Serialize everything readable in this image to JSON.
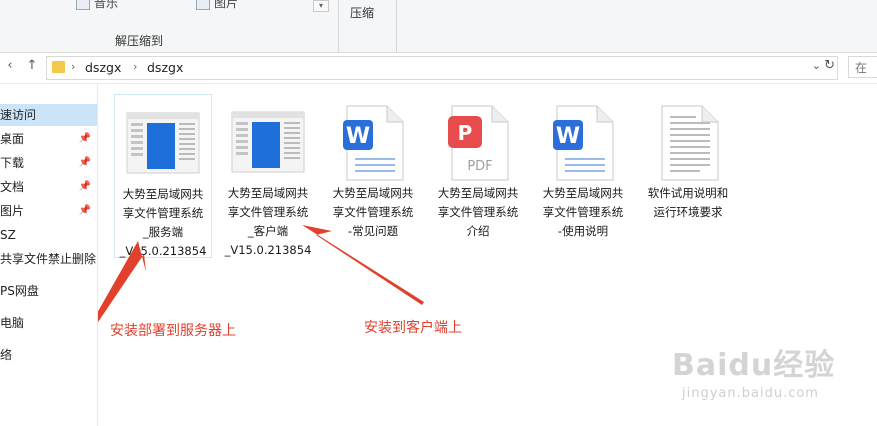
{
  "ribbon": {
    "item_music": "音乐",
    "item_pictures": "图片",
    "group_extract": "解压缩到",
    "group_compress": "压缩"
  },
  "nav": {
    "back_icon": "arrow-left-icon",
    "up_icon": "arrow-up-icon",
    "breadcrumb": [
      "dszgx",
      "dszgx"
    ],
    "search_placeholder": "在 "
  },
  "sidebar": {
    "items": [
      {
        "label": "速访问",
        "selected": true,
        "pinned": false
      },
      {
        "label": "桌面",
        "selected": false,
        "pinned": true
      },
      {
        "label": "下载",
        "selected": false,
        "pinned": true
      },
      {
        "label": "文档",
        "selected": false,
        "pinned": true
      },
      {
        "label": "图片",
        "selected": false,
        "pinned": true
      },
      {
        "label": "SZ",
        "selected": false,
        "pinned": false
      },
      {
        "label": "共享文件禁止删除",
        "selected": false,
        "pinned": false
      },
      {
        "label": "PS网盘",
        "selected": false,
        "pinned": false
      },
      {
        "label": "电脑",
        "selected": false,
        "pinned": false
      },
      {
        "label": "络",
        "selected": false,
        "pinned": false
      }
    ]
  },
  "files": [
    {
      "type": "exe",
      "name_lines": [
        "大势至局域网共",
        "享文件管理系统",
        "_服务端",
        "_V15.0.213854"
      ],
      "selected": true
    },
    {
      "type": "exe",
      "name_lines": [
        "大势至局域网共",
        "享文件管理系统",
        "_客户端",
        "_V15.0.213854"
      ],
      "selected": false
    },
    {
      "type": "word",
      "name_lines": [
        "大势至局域网共",
        "享文件管理系统",
        "-常见问题"
      ],
      "selected": false
    },
    {
      "type": "pdf",
      "name_lines": [
        "大势至局域网共",
        "享文件管理系统",
        "介绍"
      ],
      "selected": false
    },
    {
      "type": "word",
      "name_lines": [
        "大势至局域网共",
        "享文件管理系统",
        "-使用说明"
      ],
      "selected": false
    },
    {
      "type": "txt",
      "name_lines": [
        "软件试用说明和",
        "运行环境要求"
      ],
      "selected": false
    }
  ],
  "annotations": {
    "server_label": "安装部署到服务器上",
    "client_label": "安装到客户端上",
    "color": "#e0402c"
  },
  "watermark": {
    "logo": "Baidu经验",
    "url": "jingyan.baidu.com"
  },
  "colors": {
    "selection": "#cce4f7",
    "folder": "#f3c84b",
    "word_blue": "#2b6ed9",
    "pdf_red": "#e84b4b"
  }
}
